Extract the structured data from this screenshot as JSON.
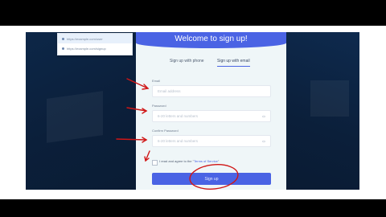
{
  "popup": {
    "items": [
      "https://example.com/user",
      "https://example.com/signup"
    ]
  },
  "panel": {
    "title": "Welcome to sign up!",
    "tabs": [
      "Sign up with phone",
      "Sign up with email"
    ],
    "fields": [
      {
        "label": "Email",
        "placeholder": "Email address"
      },
      {
        "label": "Password",
        "placeholder": "6-20 letters and numbers"
      },
      {
        "label": "Confirm Password",
        "placeholder": "6-20 letters and numbers"
      }
    ],
    "terms_text": "I read and agree to the",
    "terms_link": "Terms of Service",
    "submit": "Sign up"
  },
  "colors": {
    "accent": "#4a63e4",
    "background": "#0b1f3a",
    "annotation": "#d01616"
  }
}
